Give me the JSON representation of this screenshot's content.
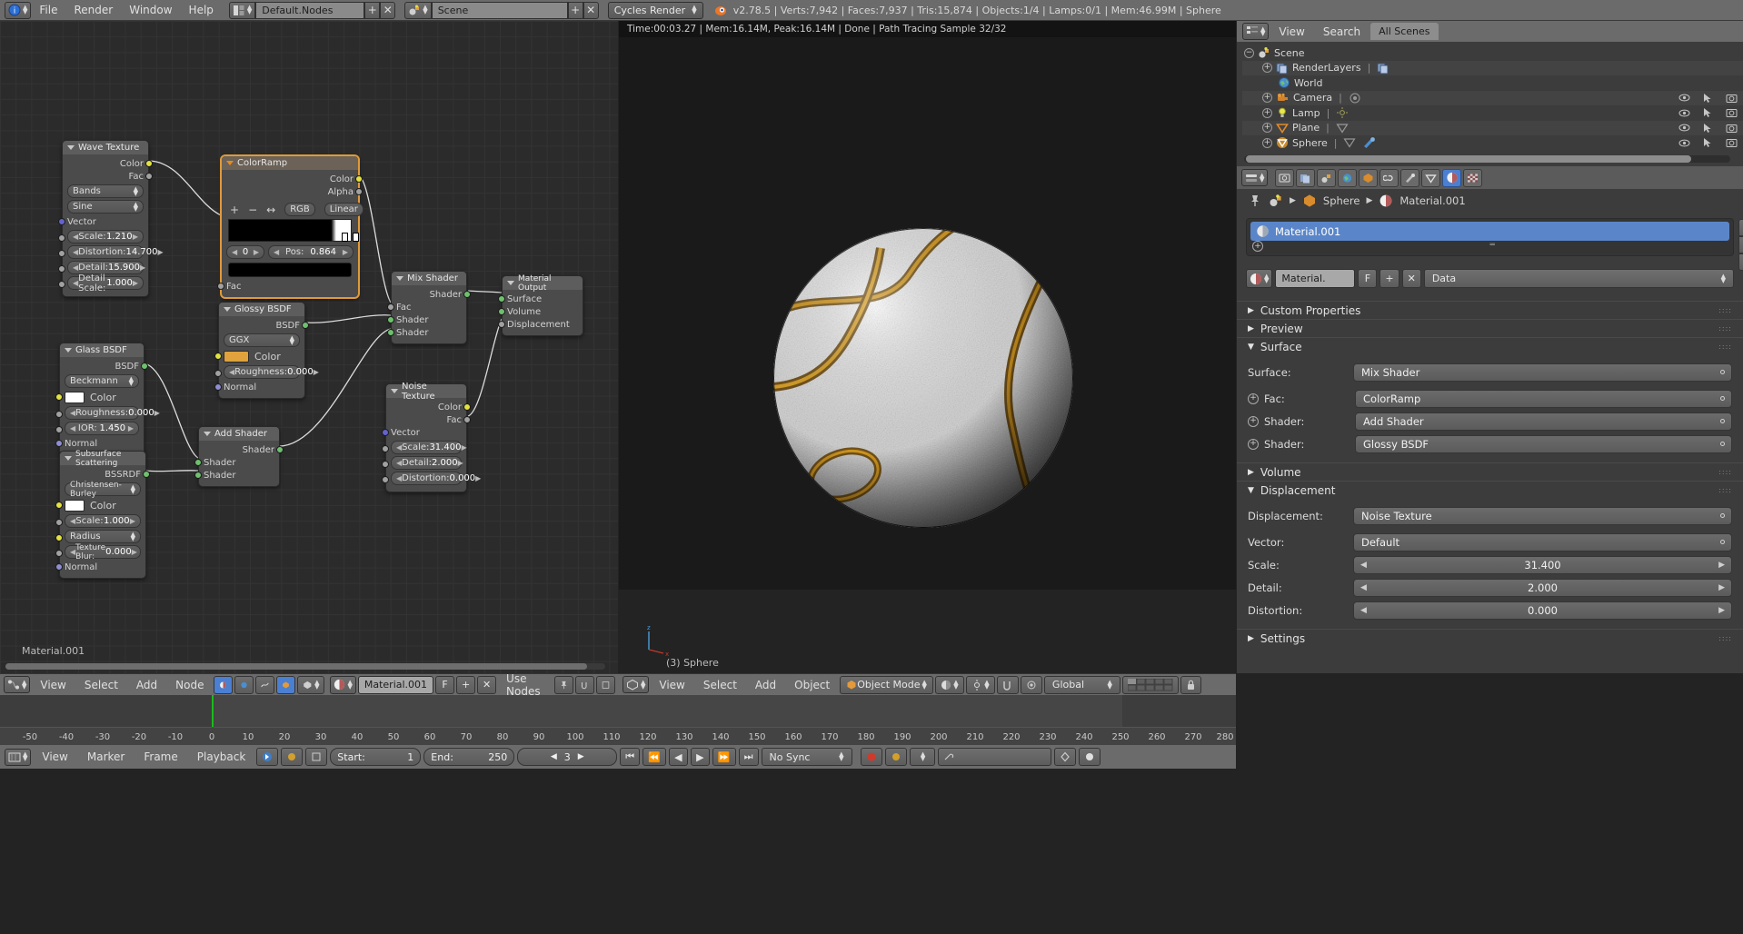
{
  "topbar": {
    "app_icon": "blender-info-icon",
    "menus": [
      "File",
      "Render",
      "Window",
      "Help"
    ],
    "screen_layout": "Default.Nodes",
    "scene_name": "Scene",
    "render_engine": "Cycles Render",
    "status": "v2.78.5 | Verts:7,942 | Faces:7,937 | Tris:15,874 | Objects:1/4 | Lamps:0/1 | Mem:46.99M | Sphere",
    "add_label": "+",
    "remove_label": "✕"
  },
  "node_editor": {
    "material_label": "Material.001",
    "footer": {
      "menus": [
        "View",
        "Select",
        "Add",
        "Node"
      ],
      "datablock": "Material.001",
      "fake_user": "F",
      "add": "+",
      "remove": "✕",
      "use_nodes": "Use Nodes"
    },
    "nodes": [
      {
        "name": "Wave Texture",
        "outputs": [
          "Color",
          "Fac"
        ],
        "enums": [
          "Bands",
          "Sine"
        ],
        "inputs": [
          "Vector"
        ],
        "values": [
          {
            "label": "Scale:",
            "value": "1.210"
          },
          {
            "label": "Distortion:",
            "value": "14.700"
          },
          {
            "label": "Detail:",
            "value": "15.900"
          },
          {
            "label": "Detail Scale:",
            "value": "1.000"
          }
        ]
      },
      {
        "name": "ColorRamp",
        "selected": true,
        "outputs": [
          "Color",
          "Alpha"
        ],
        "tools": [
          "+",
          "−",
          "↔"
        ],
        "interp_color": "RGB",
        "interp_mode": "Linear",
        "index": "0",
        "pos_label": "Pos:",
        "pos_value": "0.864",
        "inputs": [
          "Fac"
        ]
      },
      {
        "name": "Glossy BSDF",
        "outputs": [
          "BSDF"
        ],
        "enums": [
          "GGX"
        ],
        "color_label": "Color",
        "color_hex": "#e0a23c",
        "values": [
          {
            "label": "Roughness:",
            "value": "0.000"
          }
        ],
        "inputs": [
          "Normal"
        ]
      },
      {
        "name": "Glass BSDF",
        "outputs": [
          "BSDF"
        ],
        "enums": [
          "Beckmann"
        ],
        "color_label": "Color",
        "color_hex": "#ffffff",
        "values": [
          {
            "label": "Roughness:",
            "value": "0.000"
          },
          {
            "label": "IOR:",
            "value": "1.450"
          }
        ],
        "inputs": [
          "Normal"
        ]
      },
      {
        "name": "Subsurface Scattering",
        "outputs": [
          "BSSRDF"
        ],
        "enums": [
          "Christensen-Burley"
        ],
        "color_label": "Color",
        "color_hex": "#ffffff",
        "values": [
          {
            "label": "Scale:",
            "value": "1.000"
          },
          {
            "label": "Radius",
            "value": ""
          },
          {
            "label": "Texture Blur:",
            "value": "0.000"
          }
        ],
        "inputs": [
          "Normal"
        ]
      },
      {
        "name": "Add Shader",
        "outputs": [
          "Shader"
        ],
        "inputs": [
          "Shader",
          "Shader"
        ]
      },
      {
        "name": "Mix Shader",
        "outputs": [
          "Shader"
        ],
        "inputs": [
          "Fac",
          "Shader",
          "Shader"
        ]
      },
      {
        "name": "Noise Texture",
        "outputs": [
          "Color",
          "Fac"
        ],
        "inputs": [
          "Vector"
        ],
        "values": [
          {
            "label": "Scale:",
            "value": "31.400"
          },
          {
            "label": "Detail:",
            "value": "2.000"
          },
          {
            "label": "Distortion:",
            "value": "0.000"
          }
        ]
      },
      {
        "name": "Material Output",
        "inputs": [
          "Surface",
          "Volume",
          "Displacement"
        ]
      }
    ]
  },
  "viewport": {
    "render_status": "Time:00:03.27 | Mem:16.14M, Peak:16.14M | Done | Path Tracing Sample 32/32",
    "object_label": "(3) Sphere",
    "footer": {
      "menus": [
        "View",
        "Select",
        "Add",
        "Object"
      ],
      "mode": "Object Mode",
      "orientation": "Global"
    }
  },
  "outliner": {
    "header": {
      "view": "View",
      "search": "Search",
      "display": "All Scenes"
    },
    "rows": [
      {
        "label": "Scene",
        "indent": 0,
        "icon": "scene-icon",
        "expander": "−",
        "icons": []
      },
      {
        "label": "RenderLayers",
        "indent": 1,
        "icon": "renderlayers-icon",
        "expander": "+",
        "extra": "renderlayer-icon",
        "icons": []
      },
      {
        "label": "World",
        "indent": 1,
        "icon": "world-icon",
        "expander": "",
        "icons": []
      },
      {
        "label": "Camera",
        "indent": 1,
        "icon": "camera-icon",
        "expander": "+",
        "extra": "camera-data-icon",
        "icons": [
          "eye-icon",
          "cursor-icon",
          "render-icon"
        ]
      },
      {
        "label": "Lamp",
        "indent": 1,
        "icon": "lamp-icon",
        "expander": "+",
        "extra": "lamp-data-icon",
        "icons": [
          "eye-icon",
          "cursor-icon",
          "render-icon"
        ]
      },
      {
        "label": "Plane",
        "indent": 1,
        "icon": "mesh-icon",
        "expander": "+",
        "extra": "mesh-data-icon",
        "icons": [
          "eye-icon",
          "cursor-icon",
          "render-icon"
        ]
      },
      {
        "label": "Sphere",
        "indent": 1,
        "icon": "mesh-icon-active",
        "expander": "+",
        "extra": "mesh-data-icon",
        "extra2": "modifier-icon",
        "icons": [
          "eye-icon",
          "cursor-icon",
          "render-icon"
        ]
      }
    ]
  },
  "properties": {
    "tabs": [
      "render-icon",
      "renderlayers-icon",
      "scene-icon",
      "world-icon",
      "object-icon",
      "constraint-icon",
      "modifier-icon",
      "data-icon",
      "material-icon",
      "texture-icon"
    ],
    "active_tab_index": 8,
    "breadcrumb": [
      "Sphere",
      "Material.001"
    ],
    "material_slot": "Material.001",
    "material_datablock": "Material.",
    "fake_user": "F",
    "add": "+",
    "remove": "✕",
    "data_dropdown": "Data",
    "panels": [
      {
        "label": "Custom Properties",
        "open": false
      },
      {
        "label": "Preview",
        "open": false
      },
      {
        "label": "Surface",
        "open": true
      },
      {
        "label": "Volume",
        "open": false
      },
      {
        "label": "Displacement",
        "open": true
      },
      {
        "label": "Settings",
        "open": false
      }
    ],
    "surface_rows": [
      {
        "label": "Surface:",
        "value": "Mix Shader",
        "link": false
      },
      {
        "label": "Fac:",
        "value": "ColorRamp",
        "link": true
      },
      {
        "label": "Shader:",
        "value": "Add Shader",
        "link": true
      },
      {
        "label": "Shader:",
        "value": "Glossy BSDF",
        "link": true
      }
    ],
    "displacement_rows": [
      {
        "label": "Displacement:",
        "value": "Noise Texture",
        "link": false
      },
      {
        "label": "Vector:",
        "value": "Default",
        "link": false
      }
    ],
    "displacement_sliders": [
      {
        "label": "Scale:",
        "value": "31.400"
      },
      {
        "label": "Detail:",
        "value": "2.000"
      },
      {
        "label": "Distortion:",
        "value": "0.000"
      }
    ]
  },
  "timeline": {
    "ticks": [
      "-50",
      "-40",
      "-30",
      "-20",
      "-10",
      "0",
      "10",
      "20",
      "30",
      "40",
      "50",
      "60",
      "70",
      "80",
      "90",
      "100",
      "110",
      "120",
      "130",
      "140",
      "150",
      "160",
      "170",
      "180",
      "190",
      "200",
      "210",
      "220",
      "230",
      "240",
      "250",
      "260",
      "270",
      "280"
    ],
    "footer": {
      "menus": [
        "View",
        "Marker",
        "Frame",
        "Playback"
      ],
      "start_label": "Start:",
      "start_value": "1",
      "end_label": "End:",
      "end_value": "250",
      "current_frame": "3",
      "sync_mode": "No Sync"
    }
  }
}
